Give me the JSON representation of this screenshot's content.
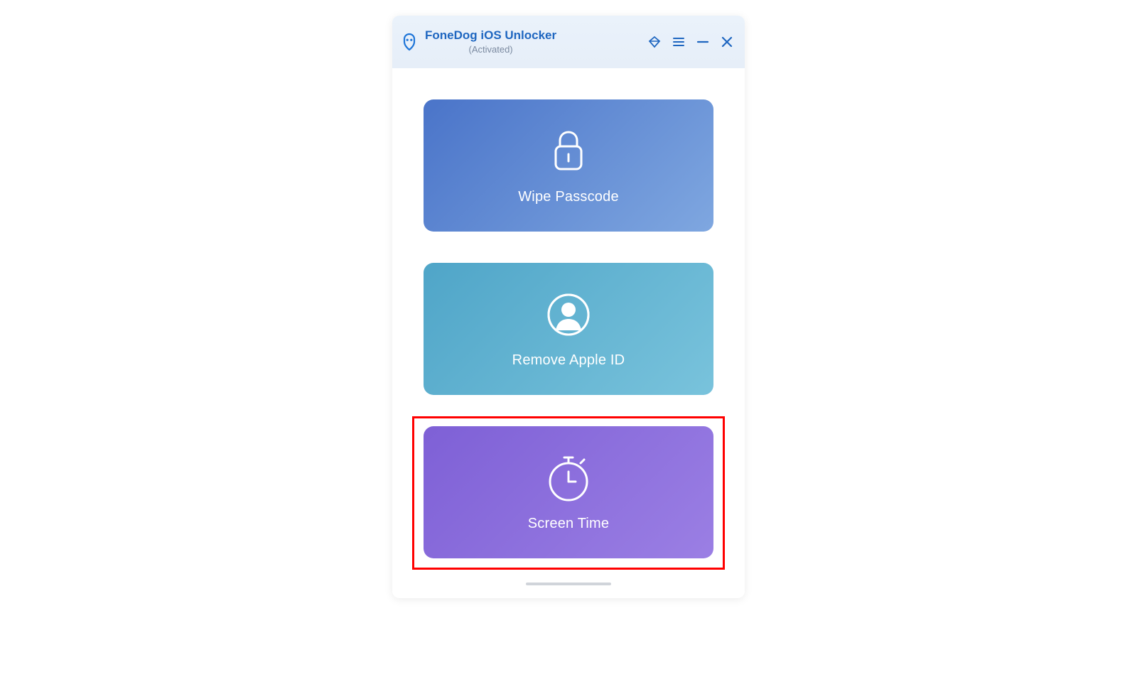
{
  "header": {
    "title": "FoneDog iOS Unlocker",
    "status": "(Activated)"
  },
  "cards": {
    "wipe": {
      "label": "Wipe Passcode"
    },
    "remove": {
      "label": "Remove Apple ID"
    },
    "screentime": {
      "label": "Screen Time"
    }
  }
}
